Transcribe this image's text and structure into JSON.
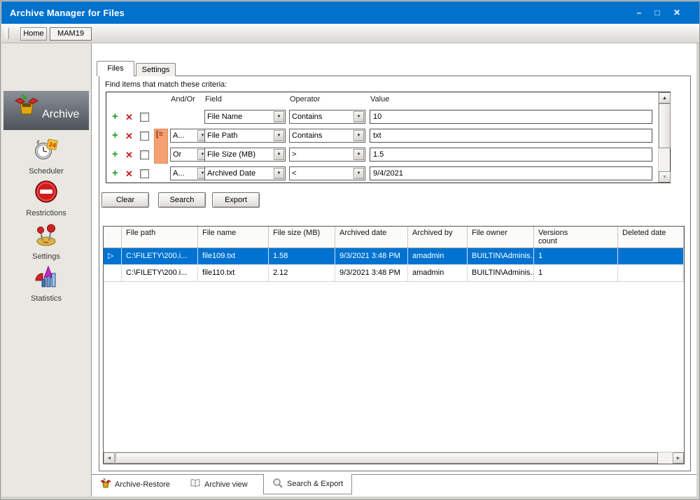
{
  "window": {
    "title": "Archive Manager for Files",
    "controls": {
      "minimize": "–",
      "maximize": "□",
      "close": "✕"
    }
  },
  "toolbar": {
    "home": "Home",
    "mam19": "MAM19"
  },
  "sidebar": {
    "items": [
      {
        "label": "Archive",
        "icon": "archive-box-icon",
        "selected": true
      },
      {
        "label": "Scheduler",
        "icon": "scheduler-clock-icon",
        "selected": false
      },
      {
        "label": "Restrictions",
        "icon": "restrictions-no-entry-icon",
        "selected": false
      },
      {
        "label": "Settings",
        "icon": "settings-joystick-icon",
        "selected": false
      },
      {
        "label": "Statistics",
        "icon": "statistics-chart-icon",
        "selected": false
      }
    ]
  },
  "page_tabs": {
    "files": "Files",
    "settings": "Settings",
    "active": "Files"
  },
  "criteria": {
    "label": "Find items that match these criteria:",
    "headers": {
      "andor": "And/Or",
      "field": "Field",
      "operator": "Operator",
      "value": "Value"
    },
    "rows": [
      {
        "andor": "",
        "field": "File Name",
        "operator": "Contains",
        "value": "10",
        "grouped": false
      },
      {
        "andor": "A...",
        "field": "File Path",
        "operator": "Contains",
        "value": "txt",
        "grouped": true
      },
      {
        "andor": "Or",
        "field": "File Size (MB)",
        "operator": ">",
        "value": "1.5",
        "grouped": true
      },
      {
        "andor": "A...",
        "field": "Archived Date",
        "operator": "<",
        "value": "9/4/2021",
        "grouped": false
      }
    ]
  },
  "actions": {
    "clear": "Clear",
    "search": "Search",
    "export": "Export"
  },
  "results": {
    "columns": [
      "File path",
      "File name",
      "File size (MB)",
      "Archived date",
      "Archived by",
      "File owner",
      "Versions count",
      "Deleted date"
    ],
    "rows": [
      [
        "C:\\FILETY\\200.i...",
        "file109.txt",
        "1.58",
        "9/3/2021 3:48 PM",
        "amadmin",
        "BUILTIN\\Adminis...",
        "1",
        ""
      ],
      [
        "C:\\FILETY\\200.i...",
        "file110.txt",
        "2.12",
        "9/3/2021 3:48 PM",
        "amadmin",
        "BUILTIN\\Adminis...",
        "1",
        ""
      ]
    ],
    "selected_row_index": 0
  },
  "bottom_tabs": [
    {
      "label": "Archive-Restore",
      "icon": "archive-box-icon",
      "active": false
    },
    {
      "label": "Archive view",
      "icon": "book-icon",
      "active": false
    },
    {
      "label": "Search & Export",
      "icon": "magnifier-icon",
      "active": true
    }
  ],
  "icons": {
    "add": "+",
    "remove": "✕",
    "combo_arrow": "▼",
    "scroll_up": "▲",
    "scroll_down": "▼",
    "scroll_left": "◄",
    "scroll_right": "►",
    "row_marker": "▷",
    "group_bracket": "[≡"
  },
  "colors": {
    "titlebar": "#0071cd",
    "selection": "#0073d1",
    "group_bracket_fill": "#f5a172",
    "sidebar_selected_top": "#8b9098",
    "sidebar_selected_bottom": "#4e535a"
  }
}
